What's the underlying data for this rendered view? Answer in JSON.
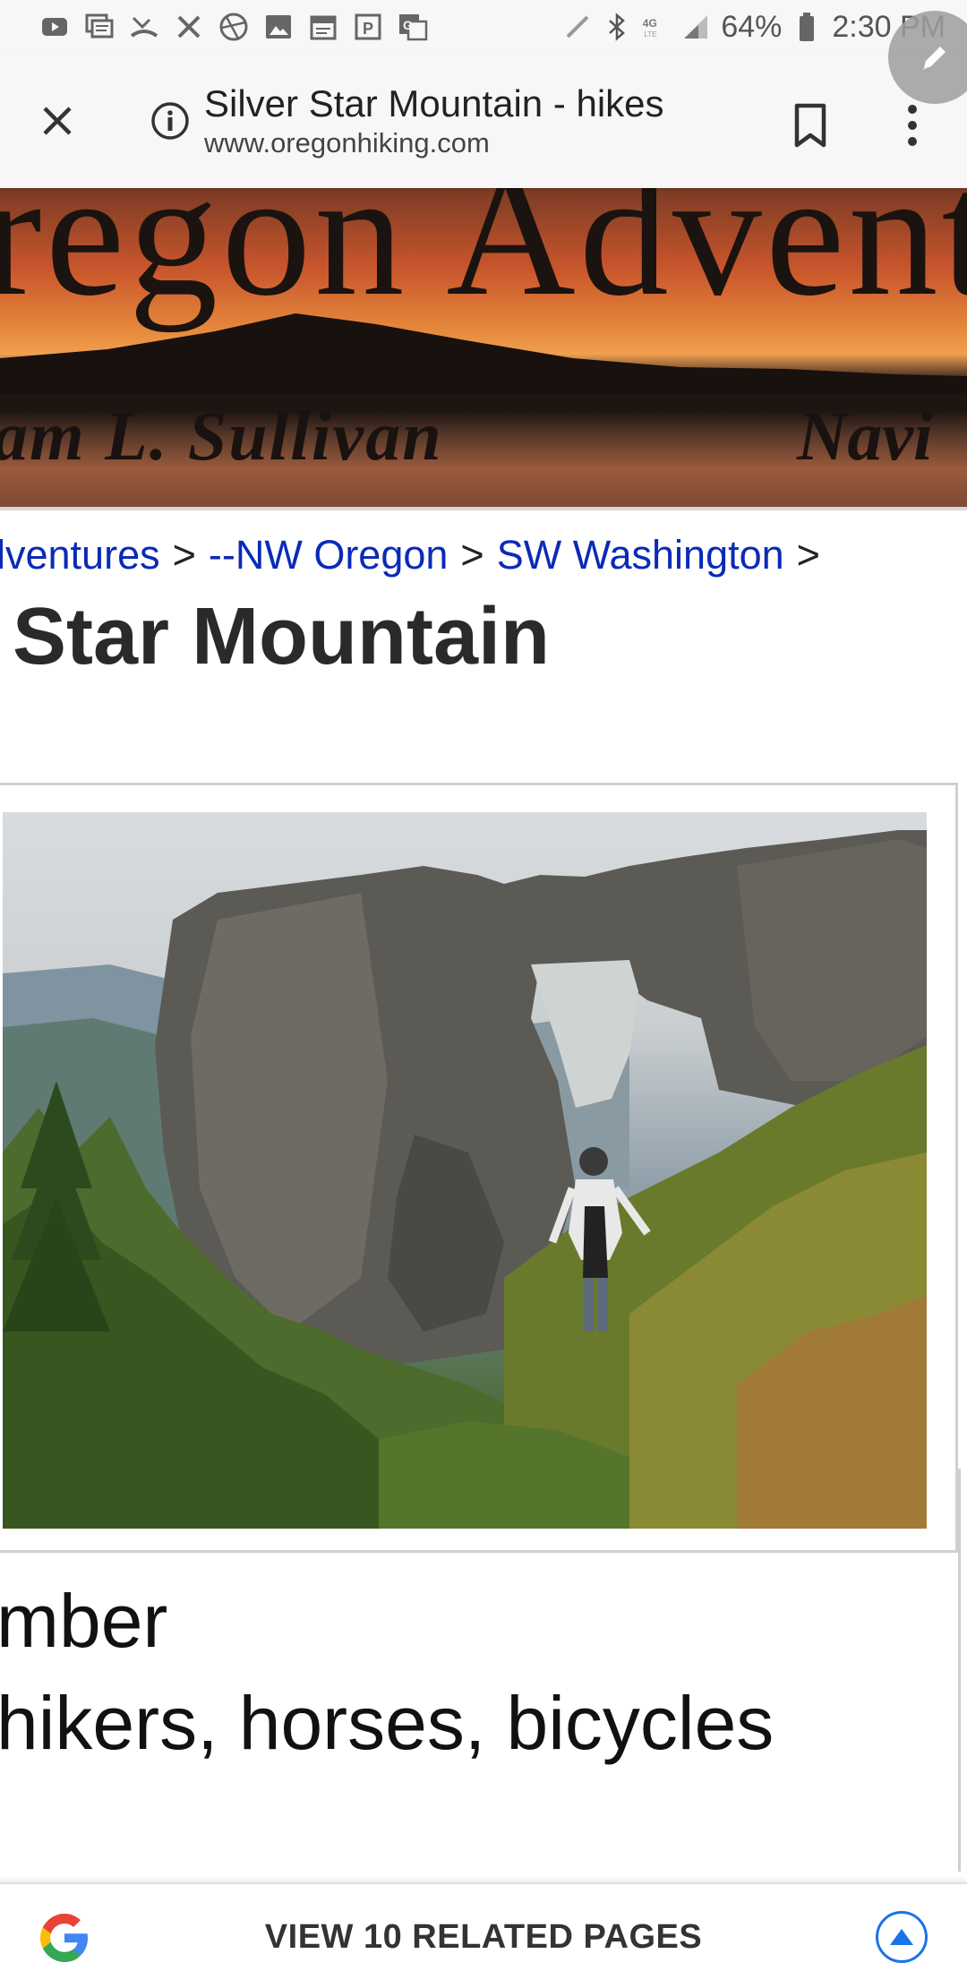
{
  "status_bar": {
    "left_icons": [
      "youtube-icon",
      "message-icon",
      "missed-call-icon",
      "tools-icon",
      "aperture-icon",
      "image-icon",
      "calendar-icon",
      "parking-icon",
      "translate-icon"
    ],
    "right_icons": [
      "edit-icon",
      "bluetooth-icon",
      "lte-icon",
      "signal-icon",
      "battery-icon"
    ],
    "network": "4G LTE",
    "battery": "64%",
    "time": "2:30 PM"
  },
  "browser": {
    "page_title": "Silver Star Mountain - hikes",
    "url": "www.oregonhiking.com",
    "icons": [
      "close-icon",
      "info-icon",
      "bookmark-icon",
      "more-vert-icon",
      "pencil-icon"
    ]
  },
  "banner": {
    "headline": "regon Advent",
    "author": "am L. Sullivan",
    "nav": "Navi",
    "colors": {
      "sky": "#e68a3c",
      "land": "#1e1512"
    }
  },
  "breadcrumb": {
    "items": [
      "lventures",
      "--NW Oregon",
      "SW Washington"
    ],
    "separator": ">",
    "link_color": "#0a2ab8"
  },
  "page": {
    "title": "Star Mountain"
  },
  "photo": {
    "subject": "rock-arch-hiker-photo"
  },
  "info": {
    "line1": "mber",
    "line2": "hikers, horses, bicycles"
  },
  "related": {
    "label": "VIEW 10 RELATED PAGES",
    "icons": [
      "google-icon",
      "expand-up-icon"
    ],
    "accent": "#1a73e8"
  }
}
